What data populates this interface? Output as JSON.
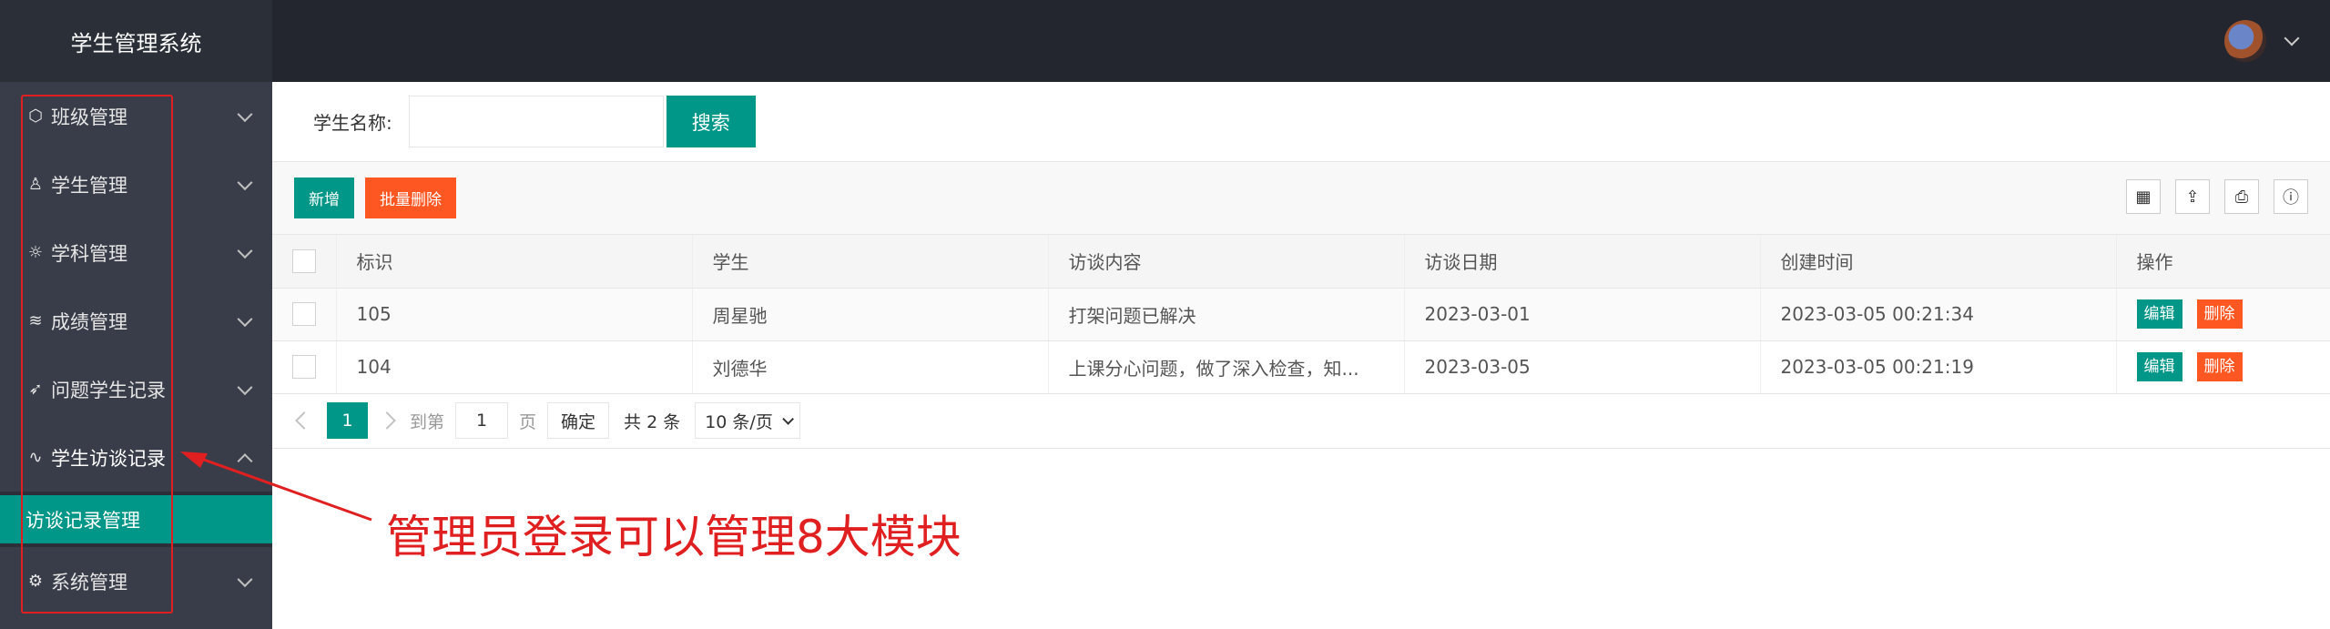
{
  "app": {
    "title": "学生管理系统"
  },
  "sidebar": {
    "items": [
      {
        "label": "班级管理",
        "icon": "cube-icon"
      },
      {
        "label": "学生管理",
        "icon": "user-icon"
      },
      {
        "label": "学科管理",
        "icon": "gear-icon"
      },
      {
        "label": "成绩管理",
        "icon": "layers-icon"
      },
      {
        "label": "问题学生记录",
        "icon": "send-icon"
      },
      {
        "label": "学生访谈记录",
        "icon": "pulse-icon",
        "expanded": true
      },
      {
        "label": "系统管理",
        "icon": "cog-icon"
      }
    ],
    "submenu": {
      "label": "访谈记录管理",
      "active": true
    }
  },
  "search": {
    "label": "学生名称:",
    "value": "",
    "button": "搜索"
  },
  "toolbar": {
    "add": "新增",
    "batch_delete": "批量删除",
    "tools": [
      "grid-icon",
      "export-icon",
      "print-icon",
      "info-icon"
    ]
  },
  "table": {
    "headers": [
      "标识",
      "学生",
      "访谈内容",
      "访谈日期",
      "创建时间",
      "操作"
    ],
    "rows": [
      {
        "id": "105",
        "student": "周星驰",
        "content": "打架问题已解决",
        "date": "2023-03-01",
        "created": "2023-03-05 00:21:34"
      },
      {
        "id": "104",
        "student": "刘德华",
        "content": "上课分心问题，做了深入检查，知...",
        "date": "2023-03-05",
        "created": "2023-03-05 00:21:19"
      }
    ],
    "actions": {
      "edit": "编辑",
      "delete": "删除"
    }
  },
  "pagination": {
    "current": "1",
    "goto_label": "到第",
    "page_input": "1",
    "page_label": "页",
    "confirm": "确定",
    "total": "共 2 条",
    "page_size": "10 条/页"
  },
  "annotation": {
    "text": "管理员登录可以管理8大模块"
  },
  "colors": {
    "primary": "#009688",
    "danger": "#ff5722",
    "sidebar": "#393d49",
    "header": "#23262e",
    "annotation": "#e02020"
  }
}
